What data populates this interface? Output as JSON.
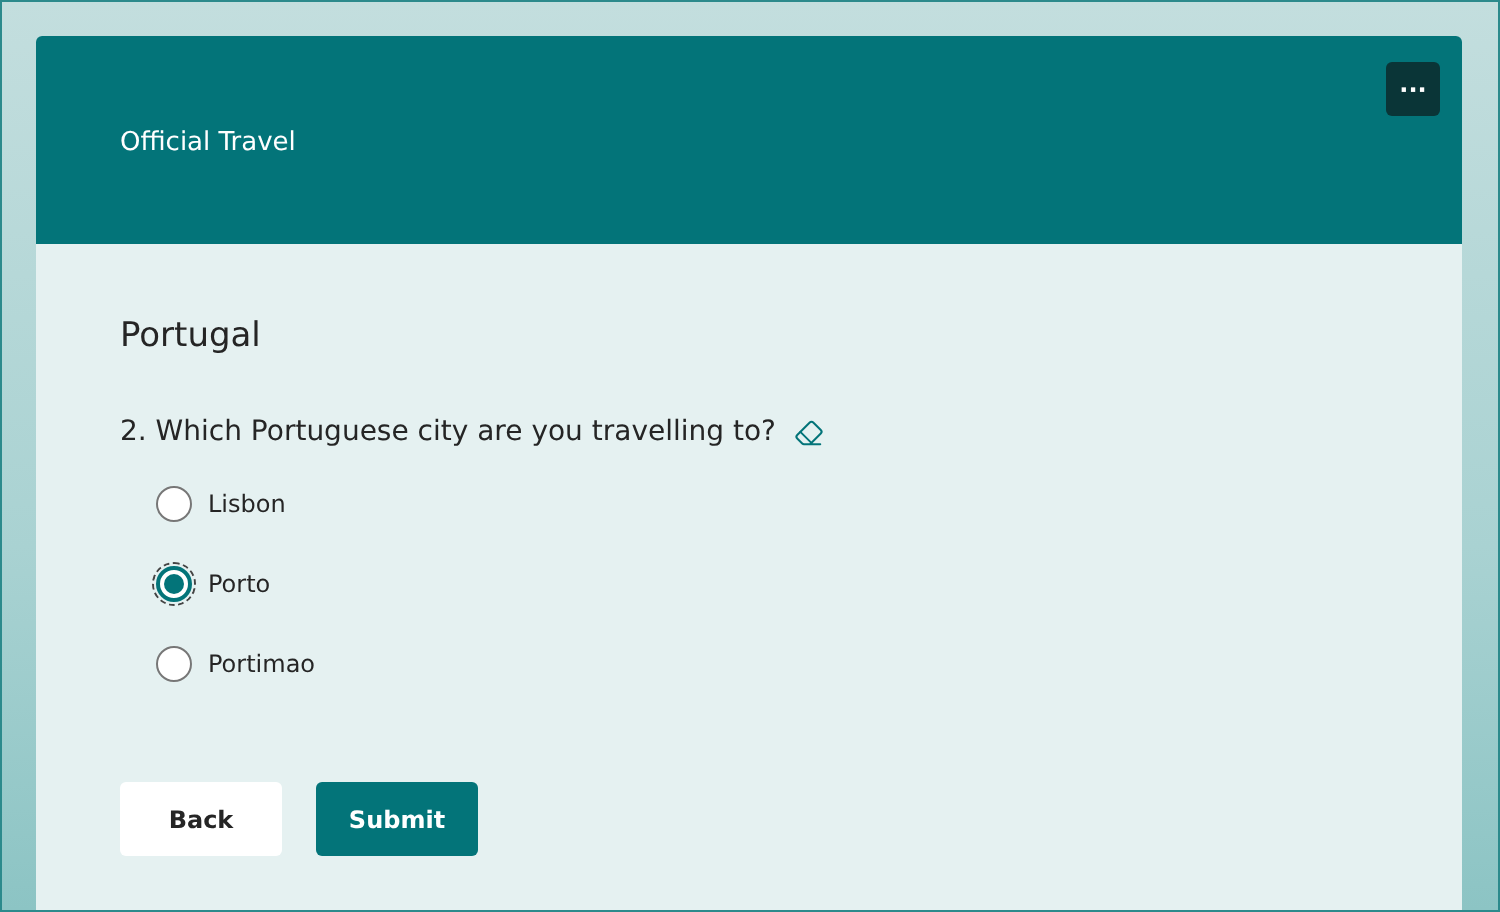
{
  "form": {
    "title": "Official Travel",
    "more_button": "···"
  },
  "section": {
    "title": "Portugal"
  },
  "question": {
    "text": "2. Which Portuguese city are you travelling to?",
    "options": [
      {
        "label": "Lisbon",
        "selected": false
      },
      {
        "label": "Porto",
        "selected": true
      },
      {
        "label": "Portimao",
        "selected": false
      }
    ]
  },
  "buttons": [
    {
      "label": "Back",
      "kind": "secondary"
    },
    {
      "label": "Submit",
      "kind": "primary"
    }
  ]
}
